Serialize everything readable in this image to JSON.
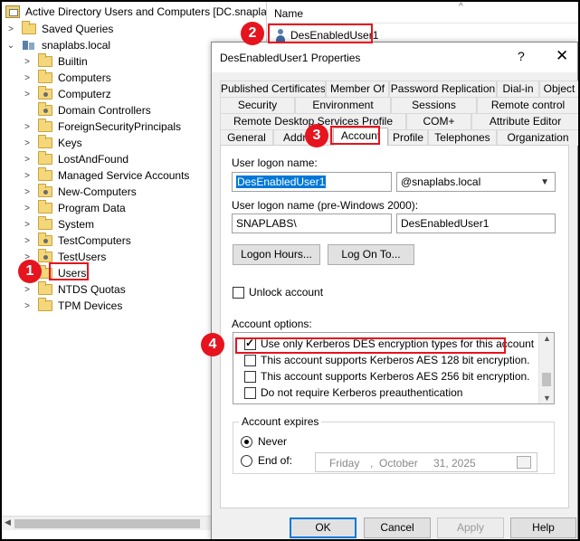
{
  "tree": {
    "root": "Active Directory Users and Computers [DC.snaplabs",
    "saved_queries": "Saved Queries",
    "domain": "snaplabs.local",
    "items": [
      "Builtin",
      "Computers",
      "Computerz",
      "Domain Controllers",
      "ForeignSecurityPrincipals",
      "Keys",
      "LostAndFound",
      "Managed Service Accounts",
      "New-Computers",
      "Program Data",
      "System",
      "TestComputers",
      "TestUsers",
      "Users",
      "NTDS Quotas",
      "TPM Devices"
    ]
  },
  "list": {
    "column_name": "Name",
    "sort_glyph": "^",
    "item": "DesEnabledUser1"
  },
  "dialog": {
    "title": "DesEnabledUser1 Properties",
    "help": "?",
    "close": "✕",
    "tabs_row1": [
      "Published Certificates",
      "Member Of",
      "Password Replication",
      "Dial-in",
      "Object"
    ],
    "tabs_row2": [
      "Security",
      "Environment",
      "Sessions",
      "Remote control"
    ],
    "tabs_row3": [
      "Remote Desktop Services Profile",
      "COM+",
      "Attribute Editor"
    ],
    "tabs_row4": [
      "General",
      "Address",
      "Account",
      "Profile",
      "Telephones",
      "Organization"
    ],
    "account": {
      "logon_label": "User logon name:",
      "logon_value": "DesEnabledUser1",
      "domain_suffix": "@snaplabs.local",
      "pre2000_label": "User logon name (pre-Windows 2000):",
      "pre2000_domain": "SNAPLABS\\",
      "pre2000_user": "DesEnabledUser1",
      "logon_hours_btn": "Logon Hours...",
      "logon_to_btn": "Log On To...",
      "unlock_label": "Unlock account",
      "options_label": "Account options:",
      "options": [
        {
          "label": "Use only Kerberos DES encryption types for this account",
          "checked": true
        },
        {
          "label": "This account supports Kerberos AES 128 bit encryption.",
          "checked": false
        },
        {
          "label": "This account supports Kerberos AES 256 bit encryption.",
          "checked": false
        },
        {
          "label": "Do not require Kerberos preauthentication",
          "checked": false
        }
      ],
      "expires_label": "Account expires",
      "never": "Never",
      "end_of": "End of:",
      "date_day": "Friday",
      "date_sep1": ",",
      "date_month": "October",
      "date_daynum": "31,",
      "date_year": "2025"
    },
    "buttons": {
      "ok": "OK",
      "cancel": "Cancel",
      "apply": "Apply",
      "help": "Help"
    }
  },
  "markers": [
    "1",
    "2",
    "3",
    "4"
  ],
  "colors": {
    "marker": "#e6141e",
    "selection": "#0078d7"
  }
}
